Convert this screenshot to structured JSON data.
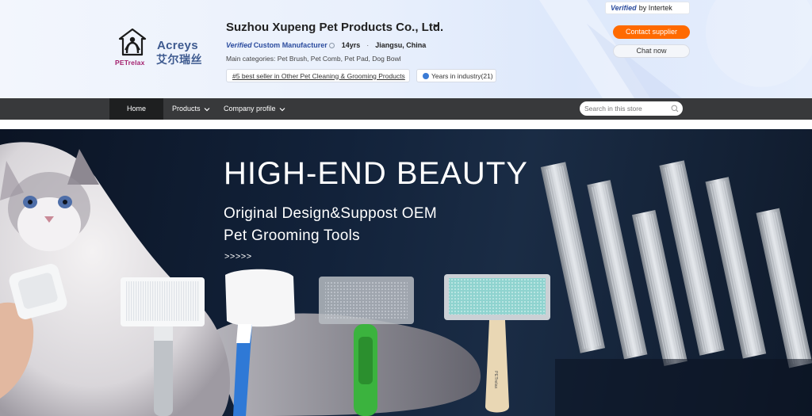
{
  "verification": {
    "verified_word": "Verified",
    "by_text": "by Intertek"
  },
  "logo": {
    "brand_petrelax": "PETrelax",
    "brand_acreys": "Acreys",
    "brand_cn": "艾尔瑞丝"
  },
  "company": {
    "name": "Suzhou Xupeng Pet Products Co., Ltd.",
    "verified_word": "Verified",
    "manufacturer_type": "Custom Manufacturer",
    "years": "14yrs",
    "separator": "·",
    "location": "Jiangsu, China",
    "main_categories": "Main categories: Pet Brush, Pet Comb, Pet Pad, Dog Bowl",
    "best_seller_tag": "#5 best seller in Other Pet Cleaning & Grooming Products",
    "years_tag": "Years in industry(21)"
  },
  "actions": {
    "contact_label": "Contact supplier",
    "chat_label": "Chat now"
  },
  "nav": {
    "home_label": "Home",
    "products_label": "Products",
    "profile_label": "Company profile",
    "search_placeholder": "Search in this store"
  },
  "banner": {
    "title": "HIGH-END BEAUTY",
    "subtitle_1": "Original Design&Suppost OEM",
    "subtitle_2": "Pet Grooming Tools",
    "arrows": ">>>>>",
    "brush_brand": "PETrelax"
  },
  "colors": {
    "accent": "#ff6a00",
    "nav_bg": "#38393b",
    "nav_active": "#1e1f20",
    "verified_blue": "#2b4c9e",
    "banner_bg": "#12223a"
  }
}
